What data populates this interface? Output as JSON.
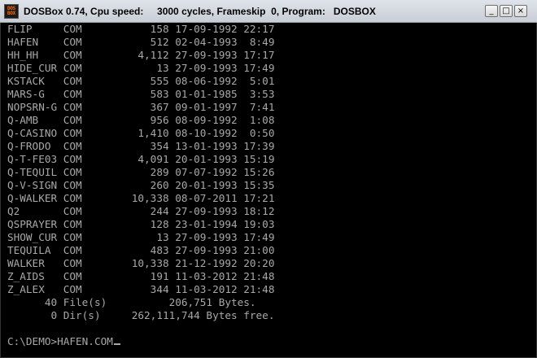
{
  "window": {
    "title": "DOSBox 0.74, Cpu speed:     3000 cycles, Frameskip  0, Program:   DOSBOX",
    "icon_text_top": "DOS",
    "icon_text_bottom": "BOX",
    "minimize_label": "_",
    "maximize_label": "□",
    "close_label": "×"
  },
  "listing": [
    {
      "name": "FLIP",
      "ext": "COM",
      "size": "158",
      "date": "17-09-1992",
      "time": "22:17"
    },
    {
      "name": "HAFEN",
      "ext": "COM",
      "size": "512",
      "date": "02-04-1993",
      "time": "8:49"
    },
    {
      "name": "HH_HH",
      "ext": "COM",
      "size": "4,112",
      "date": "27-09-1993",
      "time": "17:17"
    },
    {
      "name": "HIDE_CUR",
      "ext": "COM",
      "size": "13",
      "date": "27-09-1993",
      "time": "17:49"
    },
    {
      "name": "KSTACK",
      "ext": "COM",
      "size": "555",
      "date": "08-06-1992",
      "time": "5:01"
    },
    {
      "name": "MARS-G",
      "ext": "COM",
      "size": "583",
      "date": "01-01-1985",
      "time": "3:53"
    },
    {
      "name": "NOPSRN-G",
      "ext": "COM",
      "size": "367",
      "date": "09-01-1997",
      "time": "7:41"
    },
    {
      "name": "Q-AMB",
      "ext": "COM",
      "size": "956",
      "date": "08-09-1992",
      "time": "1:08"
    },
    {
      "name": "Q-CASINO",
      "ext": "COM",
      "size": "1,410",
      "date": "08-10-1992",
      "time": "0:50"
    },
    {
      "name": "Q-FRODO",
      "ext": "COM",
      "size": "354",
      "date": "13-01-1993",
      "time": "17:39"
    },
    {
      "name": "Q-T-FE03",
      "ext": "COM",
      "size": "4,091",
      "date": "20-01-1993",
      "time": "15:19"
    },
    {
      "name": "Q-TEQUIL",
      "ext": "COM",
      "size": "289",
      "date": "07-07-1992",
      "time": "15:26"
    },
    {
      "name": "Q-V-SIGN",
      "ext": "COM",
      "size": "260",
      "date": "20-01-1993",
      "time": "15:35"
    },
    {
      "name": "Q-WALKER",
      "ext": "COM",
      "size": "10,338",
      "date": "08-07-2011",
      "time": "17:21"
    },
    {
      "name": "Q2",
      "ext": "COM",
      "size": "244",
      "date": "27-09-1993",
      "time": "18:12"
    },
    {
      "name": "QSPRAYER",
      "ext": "COM",
      "size": "128",
      "date": "23-01-1994",
      "time": "19:03"
    },
    {
      "name": "SHOW_CUR",
      "ext": "COM",
      "size": "13",
      "date": "27-09-1993",
      "time": "17:49"
    },
    {
      "name": "TEQUILA",
      "ext": "COM",
      "size": "483",
      "date": "27-09-1993",
      "time": "21:00"
    },
    {
      "name": "WALKER",
      "ext": "COM",
      "size": "10,338",
      "date": "21-12-1992",
      "time": "20:20"
    },
    {
      "name": "Z_AIDS",
      "ext": "COM",
      "size": "191",
      "date": "11-03-2012",
      "time": "21:48"
    },
    {
      "name": "Z_ALEX",
      "ext": "COM",
      "size": "344",
      "date": "11-03-2012",
      "time": "21:48"
    }
  ],
  "summary": {
    "files_line": "      40 File(s)          206,751 Bytes.",
    "dirs_line": "       0 Dir(s)     262,111,744 Bytes free."
  },
  "prompt": {
    "text": "C:\\DEMO>HAFEN.COM"
  }
}
